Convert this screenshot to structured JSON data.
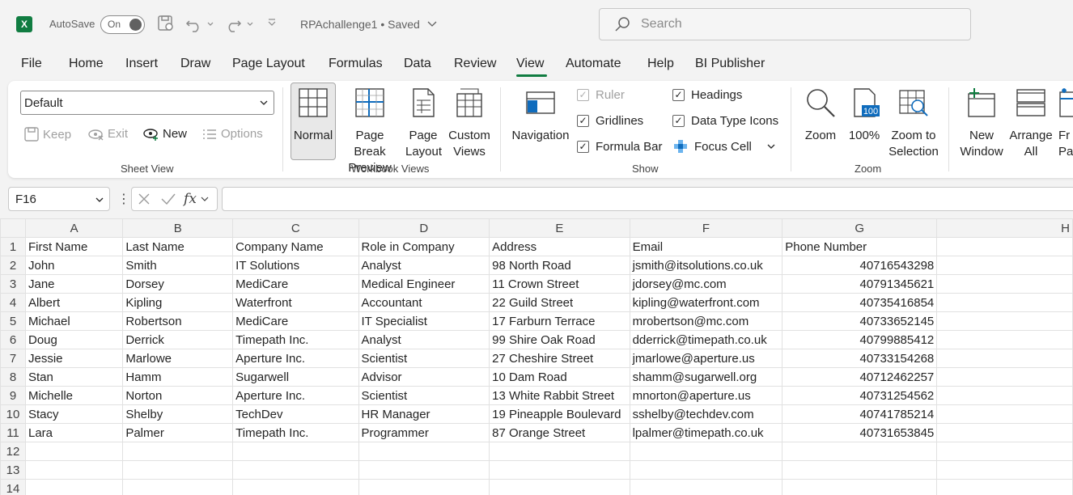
{
  "titlebar": {
    "app_icon": "X",
    "autosave_label": "AutoSave",
    "autosave_state": "On",
    "doc_title": "RPAchallenge1 • Saved",
    "search_placeholder": "Search"
  },
  "tabs": [
    "File",
    "Home",
    "Insert",
    "Draw",
    "Page Layout",
    "Formulas",
    "Data",
    "Review",
    "View",
    "Automate",
    "Help",
    "BI Publisher"
  ],
  "active_tab": "View",
  "accent_color": "#107c41",
  "ribbon": {
    "sheet_view": {
      "label": "Sheet View",
      "select_value": "Default",
      "keep": "Keep",
      "exit": "Exit",
      "new": "New",
      "options": "Options"
    },
    "workbook_views": {
      "label": "Workbook Views",
      "normal": "Normal",
      "page_break_1": "Page Break",
      "page_break_2": "Preview",
      "page_layout_1": "Page",
      "page_layout_2": "Layout",
      "custom_1": "Custom",
      "custom_2": "Views"
    },
    "show": {
      "label": "Show",
      "navigation": "Navigation",
      "ruler": "Ruler",
      "gridlines": "Gridlines",
      "formula_bar": "Formula Bar",
      "headings": "Headings",
      "data_type_icons": "Data Type Icons",
      "focus_cell": "Focus Cell"
    },
    "zoom": {
      "label": "Zoom",
      "zoom": "Zoom",
      "hundred": "100%",
      "hundred_icon": "100",
      "zoom_sel_1": "Zoom to",
      "zoom_sel_2": "Selection"
    },
    "window": {
      "new_window_1": "New",
      "new_window_2": "Window",
      "arrange_1": "Arrange",
      "arrange_2": "All",
      "freeze_1": "Fr",
      "freeze_2": "Pa"
    }
  },
  "formula_bar": {
    "name_box": "F16",
    "fx": "fx",
    "value": ""
  },
  "sheet": {
    "columns": [
      "A",
      "B",
      "C",
      "D",
      "E",
      "F",
      "G",
      "H"
    ],
    "rows": [
      [
        "First Name",
        "Last Name",
        "Company Name",
        "Role in Company",
        "Address",
        "Email",
        "Phone Number"
      ],
      [
        "John",
        "Smith",
        "IT Solutions",
        "Analyst",
        "98 North Road",
        "jsmith@itsolutions.co.uk",
        "40716543298"
      ],
      [
        "Jane",
        "Dorsey",
        "MediCare",
        "Medical Engineer",
        "11 Crown Street",
        "jdorsey@mc.com",
        "40791345621"
      ],
      [
        "Albert",
        "Kipling",
        "Waterfront",
        "Accountant",
        "22 Guild Street",
        "kipling@waterfront.com",
        "40735416854"
      ],
      [
        "Michael",
        "Robertson",
        "MediCare",
        "IT Specialist",
        "17 Farburn Terrace",
        "mrobertson@mc.com",
        "40733652145"
      ],
      [
        "Doug",
        "Derrick",
        "Timepath Inc.",
        "Analyst",
        "99 Shire Oak Road",
        "dderrick@timepath.co.uk",
        "40799885412"
      ],
      [
        "Jessie",
        "Marlowe",
        "Aperture Inc.",
        "Scientist",
        "27 Cheshire Street",
        "jmarlowe@aperture.us",
        "40733154268"
      ],
      [
        "Stan",
        "Hamm",
        "Sugarwell",
        "Advisor",
        "10 Dam Road",
        "shamm@sugarwell.org",
        "40712462257"
      ],
      [
        "Michelle",
        "Norton",
        "Aperture Inc.",
        "Scientist",
        "13 White Rabbit Street",
        "mnorton@aperture.us",
        "40731254562"
      ],
      [
        "Stacy",
        "Shelby",
        "TechDev",
        "HR Manager",
        "19 Pineapple Boulevard",
        "sshelby@techdev.com",
        "40741785214"
      ],
      [
        "Lara",
        "Palmer",
        "Timepath Inc.",
        "Programmer",
        "87 Orange Street",
        "lpalmer@timepath.co.uk",
        "40731653845"
      ],
      [
        "",
        "",
        "",
        "",
        "",
        "",
        ""
      ],
      [
        "",
        "",
        "",
        "",
        "",
        "",
        ""
      ],
      [
        "",
        "",
        "",
        "",
        "",
        "",
        ""
      ]
    ]
  }
}
